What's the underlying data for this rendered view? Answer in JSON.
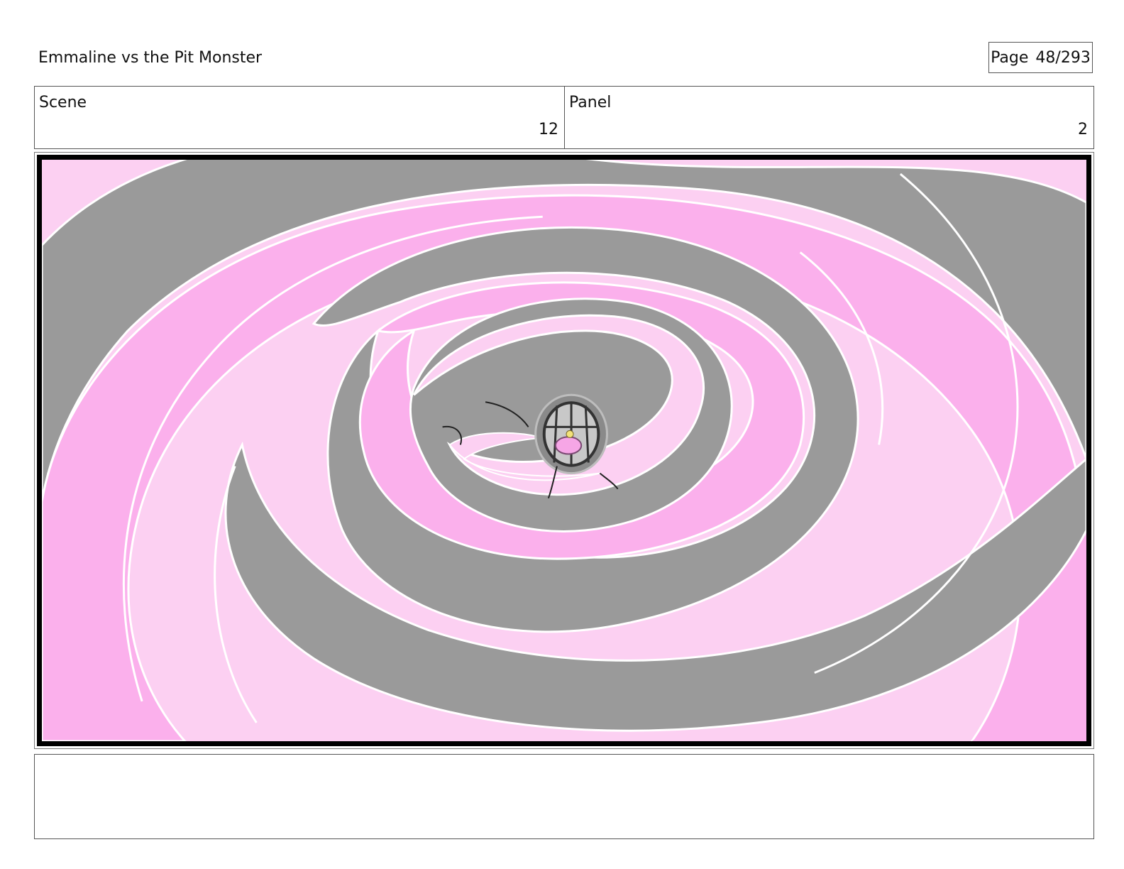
{
  "header": {
    "title": "Emmaline vs the Pit Monster",
    "page_label": "Page",
    "page_number": "48/293"
  },
  "info": {
    "scene_label": "Scene",
    "scene_value": "12",
    "panel_label": "Panel",
    "panel_value": "2"
  },
  "colors": {
    "light_pink": "#fcd0f2",
    "pink": "#fbb0ec",
    "gray": "#9a9a9a",
    "line": "#ffffff"
  },
  "notes": {
    "text": ""
  }
}
